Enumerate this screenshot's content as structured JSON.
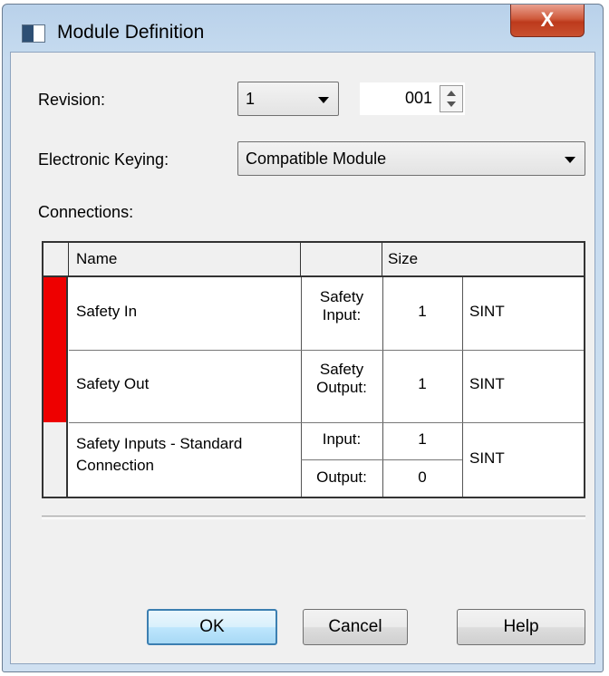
{
  "window": {
    "title": "Module Definition",
    "close_glyph": "X"
  },
  "revision": {
    "label": "Revision:",
    "major": "1",
    "minor": "001"
  },
  "keying": {
    "label": "Electronic Keying:",
    "value": "Compatible Module"
  },
  "connections": {
    "label": "Connections:",
    "headers": {
      "name": "Name",
      "type": "",
      "size": "Size"
    },
    "rows": [
      {
        "name": "Safety In",
        "type": "Safety\nInput:",
        "size": "1",
        "datatype": "SINT",
        "marker_color": "#ee0000"
      },
      {
        "name": "Safety Out",
        "type": "Safety\nOutput:",
        "size": "1",
        "datatype": "SINT",
        "marker_color": "#ee0000"
      },
      {
        "name": "Safety Inputs - Standard\nConnection",
        "type_input": "Input:",
        "size_input": "1",
        "type_output": "Output:",
        "size_output": "0",
        "datatype": "SINT",
        "marker_color": "#f0f0f0"
      }
    ]
  },
  "buttons": {
    "ok": "OK",
    "cancel": "Cancel",
    "help": "Help"
  },
  "colors": {
    "accent": "#3c7fb1",
    "marker_red": "#ee0000",
    "close_red": "#c9502f"
  },
  "icons": {
    "app": "module-window-icon",
    "close": "close-icon",
    "dropdown": "chevron-down-icon",
    "spin_up": "spin-up-icon",
    "spin_down": "spin-down-icon"
  }
}
